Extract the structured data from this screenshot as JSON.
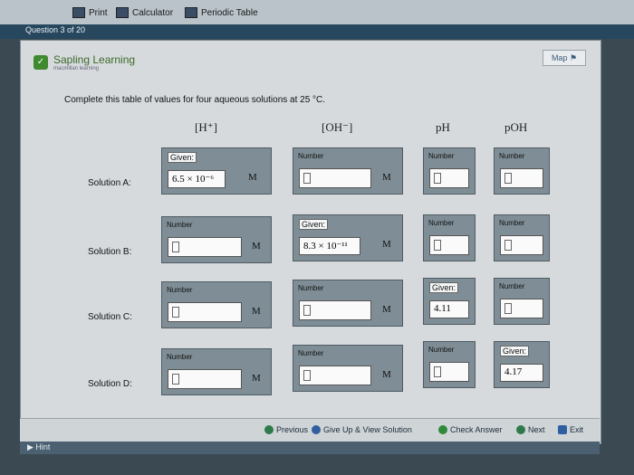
{
  "toolbar": {
    "items": [
      {
        "label": "Print",
        "icon": "printer-icon"
      },
      {
        "label": "Calculator",
        "icon": "calculator-icon"
      },
      {
        "label": "Periodic Table",
        "icon": "periodic-table-icon"
      }
    ]
  },
  "question_counter": "Question 3 of 20",
  "brand": {
    "name": "Sapling Learning",
    "sub": "macmillan learning"
  },
  "map_label": "Map",
  "prompt": "Complete this table of values for four aqueous solutions at 25 °C.",
  "headers": {
    "h": "[H⁺]",
    "oh": "[OH⁻]",
    "ph": "pH",
    "poh": "pOH"
  },
  "rows": [
    {
      "label": "Solution A:",
      "h": {
        "given": true,
        "value": "6.5 × 10⁻⁶"
      },
      "oh": {
        "given": false
      },
      "ph": {
        "given": false
      },
      "poh": {
        "given": false
      }
    },
    {
      "label": "Solution B:",
      "h": {
        "given": false
      },
      "oh": {
        "given": true,
        "value": "8.3 × 10⁻¹¹"
      },
      "ph": {
        "given": false
      },
      "poh": {
        "given": false
      }
    },
    {
      "label": "Solution C:",
      "h": {
        "given": false
      },
      "oh": {
        "given": false
      },
      "ph": {
        "given": true,
        "value": "4.11"
      },
      "poh": {
        "given": false
      }
    },
    {
      "label": "Solution D:",
      "h": {
        "given": false
      },
      "oh": {
        "given": false
      },
      "ph": {
        "given": false
      },
      "poh": {
        "given": true,
        "value": "4.17"
      }
    }
  ],
  "labels": {
    "given": "Given:",
    "number": "Number",
    "unit": "M"
  },
  "bottom_nav": {
    "previous": "Previous",
    "give_up": "Give Up & View Solution",
    "check": "Check Answer",
    "next": "Next",
    "exit": "Exit"
  },
  "hint": "Hint",
  "colors": {
    "brand_green": "#3f8a2e",
    "header_bar": "#27475e"
  }
}
